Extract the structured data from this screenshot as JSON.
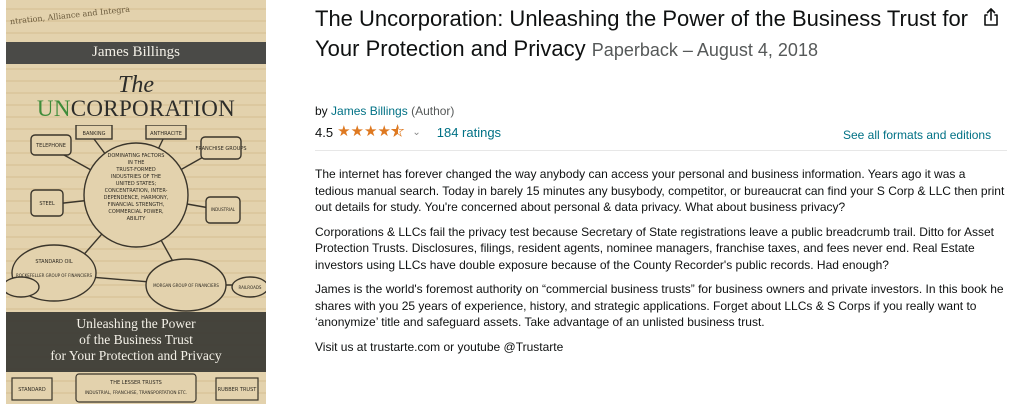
{
  "cover": {
    "author": "James Billings",
    "title_the": "The",
    "title_un": "UN",
    "title_rest": "CORPORATION",
    "subtitle_lines": [
      "Unleashing the Power",
      "of the Business Trust",
      "for Your Protection and Privacy"
    ],
    "scrawl": "ntration, Alliance and Integra",
    "diagram_center": [
      "DOMINATING FACTORS",
      "IN THE",
      "TRUST-FORMED",
      "INDUSTRIES OF THE",
      "UNITED STATES;",
      "CONCENTRATION, INTER-",
      "DEPENDENCE, HARMONY,",
      "FINANCIAL STRENGTH,",
      "COMMERCIAL POWER,",
      "ABILITY"
    ],
    "diagram_boxes": [
      {
        "label": "TELEPHONE"
      },
      {
        "label": "BANKING"
      },
      {
        "label": "ANTHRACITE"
      },
      {
        "label": "FRANCHISE GROUPS"
      },
      {
        "label": "STANDARD OIL"
      },
      {
        "label": "ROCKEFELLER GROUP OF FINANCIERS"
      },
      {
        "label": "MORGAN GROUP OF FINANCIERS"
      },
      {
        "label": "RAILROADS"
      },
      {
        "label": "STEEL"
      },
      {
        "label": "INDUSTRIAL"
      }
    ],
    "bottom_boxes": [
      "STANDARD",
      "THE LESSER TRUSTS",
      "INDUSTRIAL, FRANCHISE, TRANSPORTATION ETC.",
      "RUBBER TRUST"
    ]
  },
  "product": {
    "title": "The Uncorporation: Unleashing the Power of the Business Trust for Your Protection and Privacy",
    "binding": "Paperback – August 4, 2018",
    "by_prefix": "by",
    "author": "James Billings",
    "author_role": "(Author)",
    "rating": "4.5",
    "ratings_count": "184 ratings",
    "formats_link": "See all formats and editions"
  },
  "description": [
    "The internet has forever changed the way anybody can access your personal and business information. Years ago it was a tedious manual search. Today in barely 15 minutes any busybody, competitor, or bureaucrat can find your S Corp & LLC then print out details for study. You're concerned about personal & data privacy. What about business privacy?",
    "Corporations & LLCs fail the privacy test because Secretary of State registrations leave a public breadcrumb trail. Ditto for Asset Protection Trusts. Disclosures, filings, resident agents, nominee managers, franchise taxes, and fees never end. Real Estate investors using LLCs have double exposure because of the County Recorder's public records. Had enough?",
    "James is the world's foremost authority on “commercial business trusts” for business owners and private investors. In this book he shares with you 25 years of experience, history, and strategic applications. Forget about LLCs & S Corps if you really want to ‘anonymize’ title and safeguard assets. Take advantage of an unlisted business trust.",
    "Visit us at trustarte.com or youtube @Trustarte"
  ],
  "colors": {
    "link": "#007185",
    "star": "#de7921",
    "cover_green": "#3f8c3a",
    "cover_band": "#4a4a47"
  },
  "icons": {
    "share": "share-icon",
    "chevron": "chevron-down-icon",
    "star": "star-icon"
  }
}
